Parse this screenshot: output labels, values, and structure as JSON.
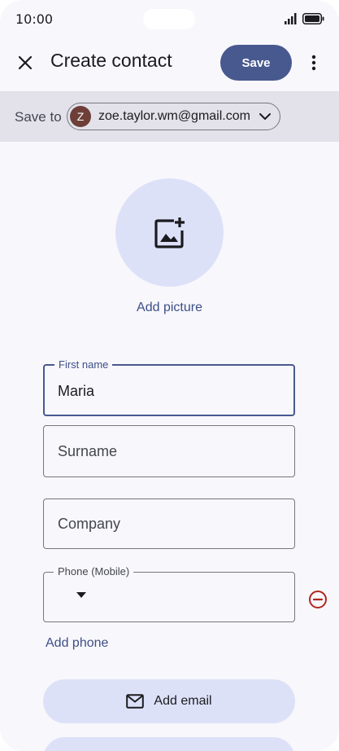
{
  "status_bar": {
    "time": "10:00"
  },
  "header": {
    "title": "Create contact",
    "save_label": "Save"
  },
  "save_to": {
    "label": "Save to",
    "account_initial": "Z",
    "account_email": "zoe.taylor.wm@gmail.com"
  },
  "photo": {
    "add_label": "Add picture"
  },
  "fields": {
    "first_name": {
      "label": "First name",
      "value": "Maria"
    },
    "surname": {
      "placeholder": "Surname"
    },
    "company": {
      "placeholder": "Company"
    },
    "phone": {
      "label": "Phone (Mobile)",
      "value": ""
    }
  },
  "actions": {
    "add_phone": "Add phone",
    "add_email": "Add email"
  },
  "colors": {
    "accent": "#48598f",
    "tonal_container": "#dde1f8",
    "error": "#b3261e",
    "avatar": "#6d3f38"
  },
  "icons": {
    "close": "close-icon",
    "more": "more-vert-icon",
    "chevron": "chevron-down-icon",
    "add_photo": "add-photo-icon",
    "remove": "remove-circle-icon",
    "email": "mail-icon"
  }
}
